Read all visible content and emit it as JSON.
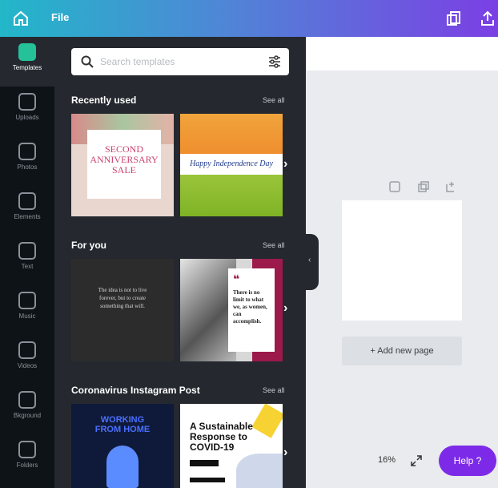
{
  "topbar": {
    "file_label": "File"
  },
  "rail": {
    "items": [
      {
        "label": "Templates",
        "icon": "templates-icon"
      },
      {
        "label": "Uploads",
        "icon": "upload-icon"
      },
      {
        "label": "Photos",
        "icon": "photos-icon"
      },
      {
        "label": "Elements",
        "icon": "elements-icon"
      },
      {
        "label": "Text",
        "icon": "text-icon"
      },
      {
        "label": "Music",
        "icon": "music-icon"
      },
      {
        "label": "Videos",
        "icon": "video-icon"
      },
      {
        "label": "Bkground",
        "icon": "background-icon"
      },
      {
        "label": "Folders",
        "icon": "folder-icon"
      }
    ]
  },
  "panel": {
    "search_placeholder": "Search templates",
    "sections": [
      {
        "title": "Recently used",
        "see_all": "See all",
        "thumbs": [
          {
            "line1": "SECOND",
            "line2": "ANNIVERSARY",
            "line3": "SALE"
          },
          {
            "caption": "Happy Independence Day"
          }
        ]
      },
      {
        "title": "For you",
        "see_all": "See all",
        "thumbs": [
          {
            "quote": "The idea is not to live forever, but to create something that will."
          },
          {
            "quote": "There is no limit to what we, as women, can accomplish."
          }
        ]
      },
      {
        "title": "Coronavirus Instagram Post",
        "see_all": "See all",
        "thumbs": [
          {
            "line1": "WORKING",
            "line2": "FROM HOME"
          },
          {
            "line1": "A Sustainable",
            "line2": "Response to",
            "line3": "COVID-19"
          }
        ]
      }
    ]
  },
  "canvas": {
    "add_page_label": "+ Add new page"
  },
  "footer": {
    "zoom": "16%",
    "help_label": "Help ?"
  },
  "colors": {
    "accent": "#7d2ae8",
    "panel": "#25292f",
    "rail": "#0e1318"
  }
}
